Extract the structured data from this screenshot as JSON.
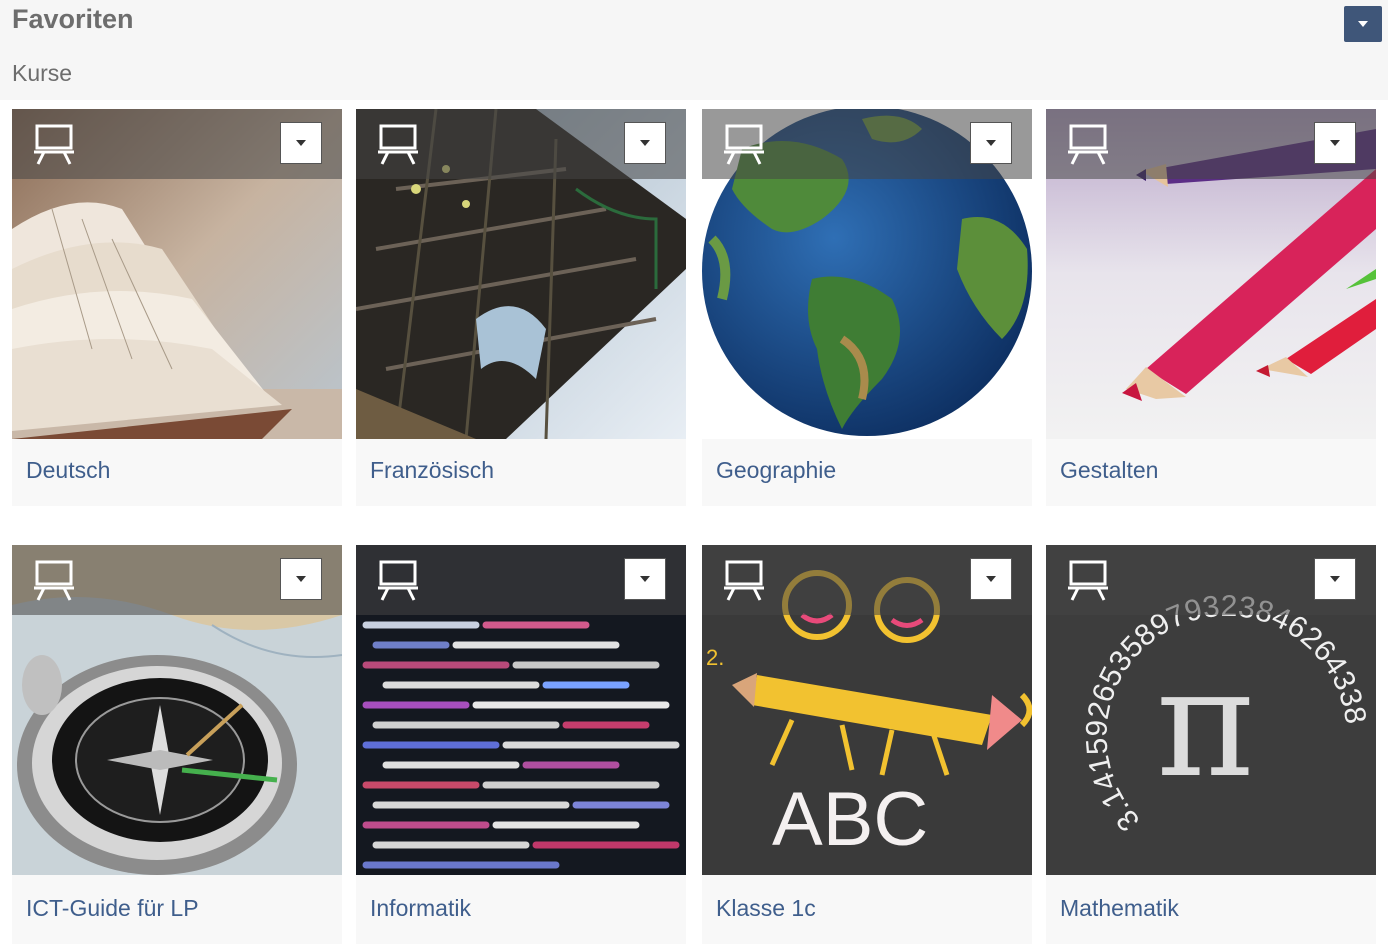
{
  "header": {
    "title": "Favoriten",
    "subtitle": "Kurse",
    "dropdown_icon": "caret-down-icon"
  },
  "courses": [
    {
      "title": "Deutsch",
      "image": "open-book-photo",
      "icon": "presentation-board-icon"
    },
    {
      "title": "Französisch",
      "image": "eiffel-tower-photo",
      "icon": "presentation-board-icon"
    },
    {
      "title": "Geographie",
      "image": "earth-globe-image",
      "icon": "presentation-board-icon"
    },
    {
      "title": "Gestalten",
      "image": "colored-pencils-photo",
      "icon": "presentation-board-icon"
    },
    {
      "title": "ICT-Guide für LP",
      "image": "compass-on-map-photo",
      "icon": "presentation-board-icon"
    },
    {
      "title": "Informatik",
      "image": "source-code-screen-photo",
      "icon": "presentation-board-icon"
    },
    {
      "title": "Klasse 1c",
      "image": "chalkboard-kids-abc-drawing",
      "icon": "presentation-board-icon"
    },
    {
      "title": "Mathematik",
      "image": "chalkboard-pi-drawing",
      "icon": "presentation-board-icon"
    }
  ],
  "image_text": {
    "klasse_abc": "ABC",
    "klasse_num": "2.",
    "pi_symbol": "π",
    "pi_digits": "3.14159265358979323846264338"
  }
}
